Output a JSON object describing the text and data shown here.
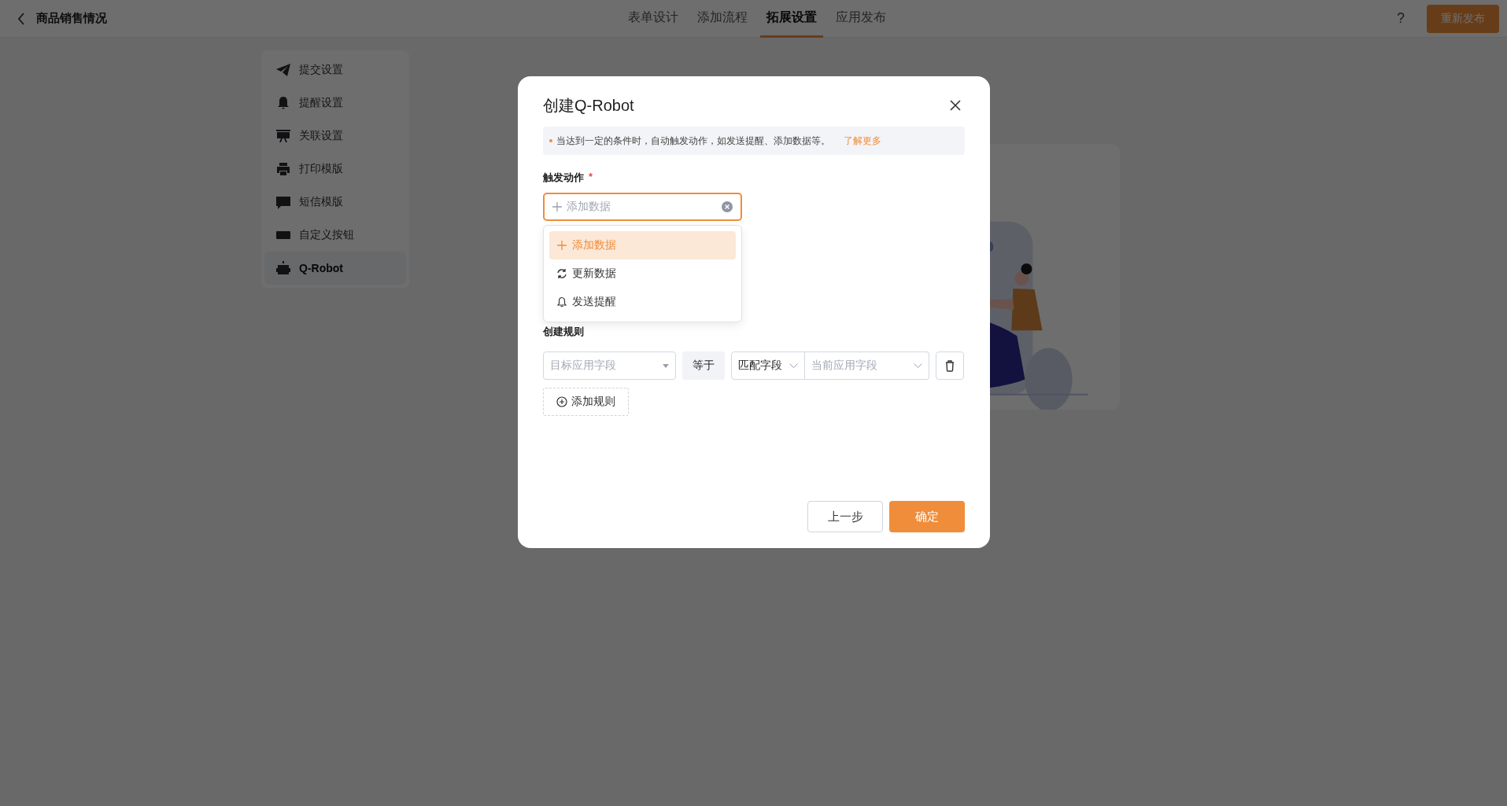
{
  "header": {
    "title": "商品销售情况",
    "tabs": [
      {
        "label": "表单设计",
        "selected": false
      },
      {
        "label": "添加流程",
        "selected": false
      },
      {
        "label": "拓展设置",
        "selected": true
      },
      {
        "label": "应用发布",
        "selected": false
      }
    ],
    "help": "?",
    "publish_button": "重新发布"
  },
  "sidebar": {
    "items": [
      {
        "label": "提交设置",
        "selected": false
      },
      {
        "label": "提醒设置",
        "selected": false
      },
      {
        "label": "关联设置",
        "selected": false
      },
      {
        "label": "打印模版",
        "selected": false
      },
      {
        "label": "短信模版",
        "selected": false
      },
      {
        "label": "自定义按钮",
        "selected": false
      },
      {
        "label": "Q-Robot",
        "selected": true
      }
    ]
  },
  "modal": {
    "title": "创建Q-Robot",
    "notice": {
      "text": "当达到一定的条件时，自动触发动作，如发送提醒、添加数据等。",
      "link": "了解更多"
    },
    "trigger": {
      "label": "触发动作",
      "required_mark": "*",
      "placeholder": "添加数据",
      "options": [
        {
          "label": "添加数据",
          "selected": true
        },
        {
          "label": "更新数据",
          "selected": false
        },
        {
          "label": "发送提醒",
          "selected": false
        }
      ]
    },
    "rules": {
      "label": "创建规则",
      "rows": [
        {
          "target_placeholder": "目标应用字段",
          "operator": "等于",
          "match_type": "匹配字段",
          "current_placeholder": "当前应用字段"
        }
      ],
      "add_button": "添加规则"
    },
    "buttons": {
      "back": "上一步",
      "confirm": "确定"
    }
  }
}
